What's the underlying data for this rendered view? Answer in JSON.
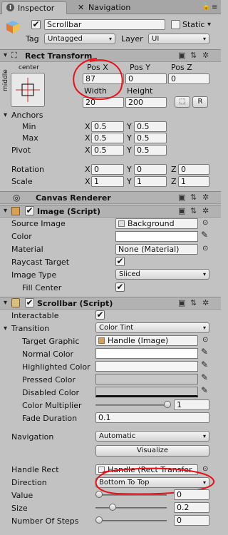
{
  "tabs": {
    "inspector": "Inspector",
    "navigation": "Navigation"
  },
  "header": {
    "name": "Scrollbar",
    "static": "Static",
    "tag_label": "Tag",
    "tag_value": "Untagged",
    "layer_label": "Layer",
    "layer_value": "UI"
  },
  "rect": {
    "title": "Rect Transform",
    "anchor_h": "center",
    "anchor_v": "middle",
    "posx_label": "Pos X",
    "posx": "87",
    "posy_label": "Pos Y",
    "posy": "0",
    "posz_label": "Pos Z",
    "posz": "0",
    "width_label": "Width",
    "width": "20",
    "height_label": "Height",
    "height": "200",
    "r_btn": "R",
    "anchors": "Anchors",
    "min": "Min",
    "max": "Max",
    "pivot": "Pivot",
    "min_x": "0.5",
    "min_y": "0.5",
    "max_x": "0.5",
    "max_y": "0.5",
    "pivot_x": "0.5",
    "pivot_y": "0.5",
    "rotation": "Rotation",
    "rot_x": "0",
    "rot_y": "0",
    "rot_z": "0",
    "scale": "Scale",
    "scale_x": "1",
    "scale_y": "1",
    "scale_z": "1",
    "X": "X",
    "Y": "Y",
    "Z": "Z"
  },
  "canvas": {
    "title": "Canvas Renderer"
  },
  "image": {
    "title": "Image (Script)",
    "source_label": "Source Image",
    "source": "Background",
    "color_label": "Color",
    "material_label": "Material",
    "material": "None (Material)",
    "raycast_label": "Raycast Target",
    "type_label": "Image Type",
    "type": "Sliced",
    "fill_label": "Fill Center"
  },
  "scrollbar": {
    "title": "Scrollbar (Script)",
    "interactable": "Interactable",
    "transition_label": "Transition",
    "transition": "Color Tint",
    "target_label": "Target Graphic",
    "target": "Handle (Image)",
    "normal": "Normal Color",
    "highlighted": "Highlighted Color",
    "pressed": "Pressed Color",
    "disabled": "Disabled Color",
    "multiplier_label": "Color Multiplier",
    "multiplier": "1",
    "fade_label": "Fade Duration",
    "fade": "0.1",
    "navigation_label": "Navigation",
    "navigation": "Automatic",
    "visualize": "Visualize",
    "handle_label": "Handle Rect",
    "handle": "Handle (Rect Transfor",
    "direction_label": "Direction",
    "direction": "Bottom To Top",
    "value_label": "Value",
    "value": "0",
    "value_frac": 0,
    "size_label": "Size",
    "size": "0.2",
    "size_frac": 0.2,
    "steps_label": "Number Of Steps",
    "steps": "0",
    "steps_frac": 0
  },
  "colors": {
    "annotation": "#e8101a"
  }
}
